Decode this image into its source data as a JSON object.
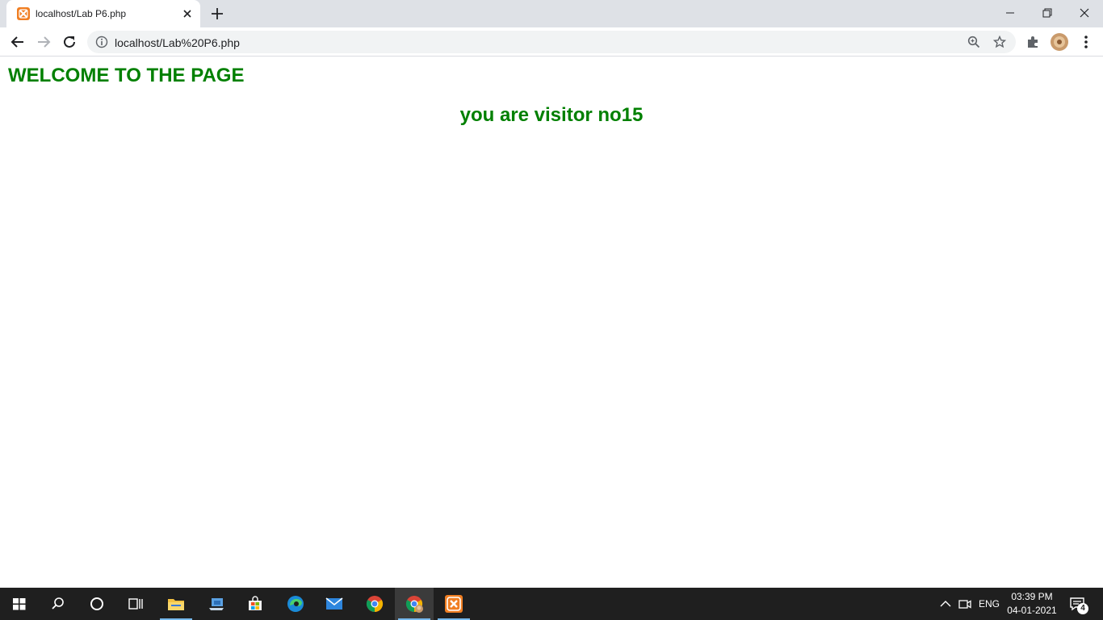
{
  "browser": {
    "tab": {
      "title": "localhost/Lab P6.php",
      "favicon": "xampp-icon"
    },
    "address_bar": {
      "url": "localhost/Lab%20P6.php"
    },
    "icons": [
      "back-arrow-icon",
      "forward-arrow-icon",
      "reload-icon",
      "info-icon",
      "zoom-icon",
      "star-icon",
      "extensions-icon",
      "profile-avatar",
      "more-vert-icon"
    ]
  },
  "page": {
    "heading": "WELCOME TO THE PAGE",
    "visitor_text": "you are visitor no15",
    "text_color": "#008000"
  },
  "taskbar": {
    "apps": [
      "windows-start-icon",
      "search-icon",
      "cortana-icon",
      "task-view-icon",
      "file-explorer-icon",
      "device-icon",
      "store-icon",
      "edge-icon",
      "mail-icon",
      "chrome-icon",
      "chrome-profile-icon",
      "xampp-icon"
    ],
    "language": "ENG",
    "time": "03:39 PM",
    "date": "04-01-2021",
    "notification_count": "4"
  }
}
